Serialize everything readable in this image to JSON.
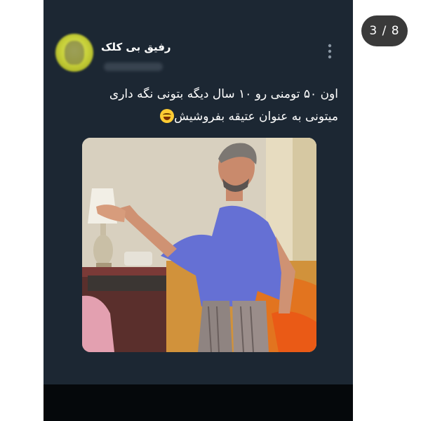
{
  "story": {
    "counter": "3 / 8"
  },
  "tweet": {
    "user_name": "رفیق بی کلک",
    "text_line_1": "اون ۵۰ تومنی رو ۱۰ سال دیگه بتونی نگه داری",
    "text_line_2": "میتونی به عنوان عتیقه بفروشیش",
    "emoji_icon": "grinning-sweat-face-emoji"
  },
  "colors": {
    "tweet_background": "#1c2733",
    "counter_pill": "#3a3a3a",
    "text": "#ffffff"
  }
}
